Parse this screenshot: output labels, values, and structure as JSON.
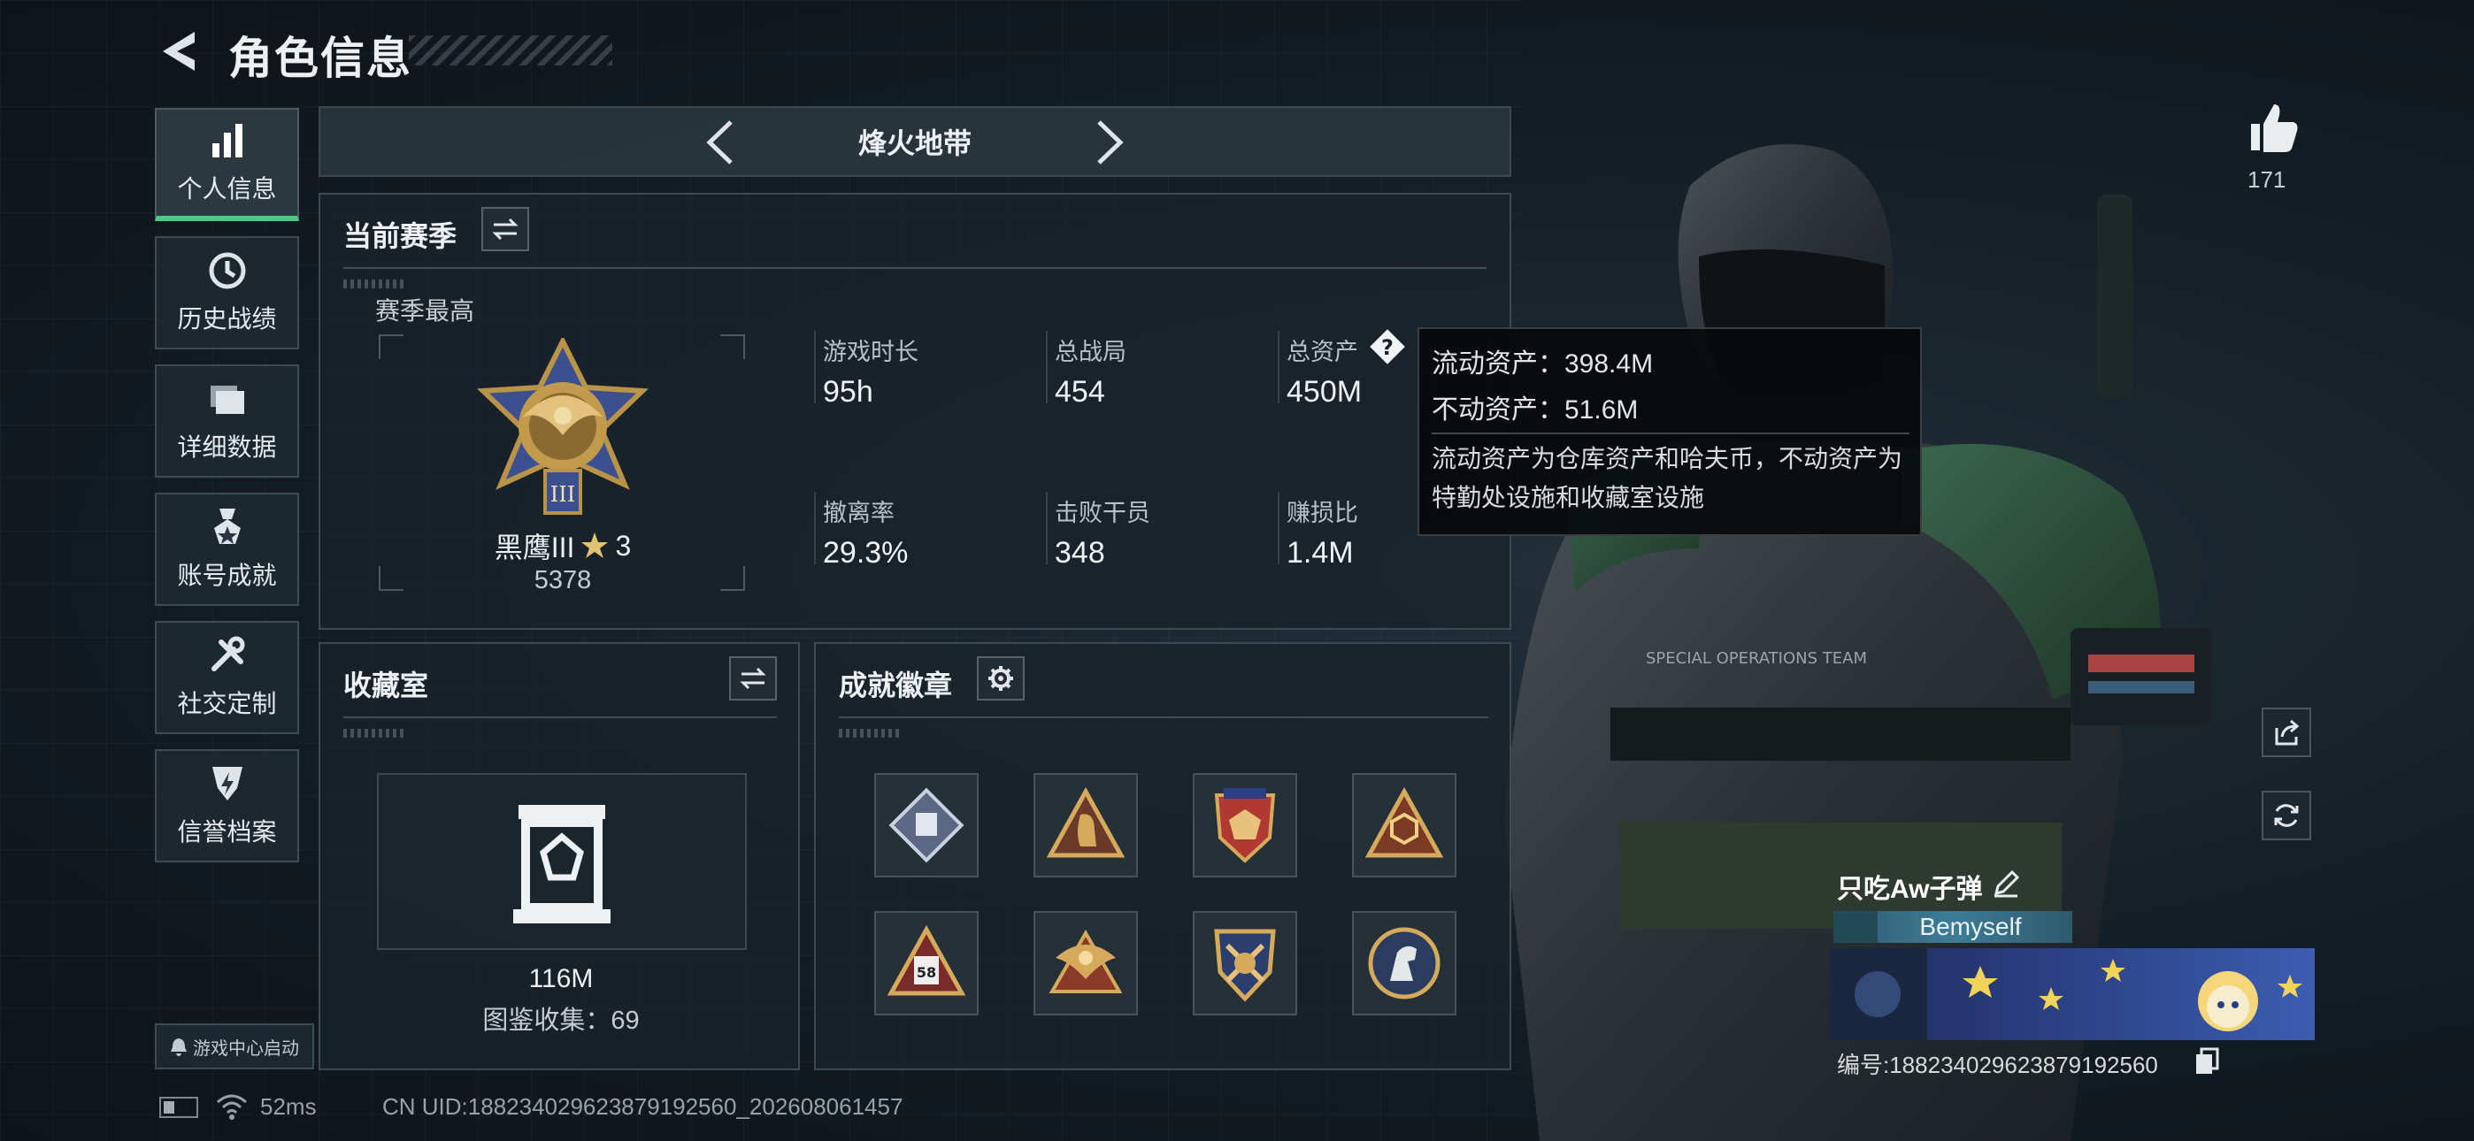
{
  "header": {
    "title": "角色信息"
  },
  "nav": {
    "items": [
      {
        "label": "个人信息",
        "icon": "bar-chart-icon",
        "active": true
      },
      {
        "label": "历史战绩",
        "icon": "clock-icon"
      },
      {
        "label": "详细数据",
        "icon": "folder-icon"
      },
      {
        "label": "账号成就",
        "icon": "medal-icon"
      },
      {
        "label": "社交定制",
        "icon": "wrench-icon"
      },
      {
        "label": "信誉档案",
        "icon": "shield-icon"
      }
    ],
    "launch_label": "游戏中心启动"
  },
  "mode": {
    "title": "烽火地带"
  },
  "season": {
    "heading": "当前赛季",
    "best_label": "赛季最高",
    "rank_name": "黑鹰III",
    "rank_stars": "3",
    "rank_score": "5378",
    "stats": [
      {
        "label": "游戏时长",
        "value": "95h"
      },
      {
        "label": "总战局",
        "value": "454"
      },
      {
        "label": "总资产",
        "value": "450M"
      },
      {
        "label": "撤离率",
        "value": "29.3%"
      },
      {
        "label": "击败干员",
        "value": "348"
      },
      {
        "label": "赚损比",
        "value": "1.4M"
      }
    ]
  },
  "tooltip": {
    "liquid": "流动资产：398.4M",
    "fixed": "不动资产：51.6M",
    "description": "流动资产为仓库资产和哈夫币，不动资产为特勤处设施和收藏室设施"
  },
  "collection": {
    "heading": "收藏室",
    "value": "116M",
    "catalog": "图鉴收集：69"
  },
  "achievements": {
    "heading": "成就徽章",
    "badges": [
      "diamond-badge",
      "bird-badge",
      "shield-star-badge",
      "hexagon-badge",
      "triangle-58-badge",
      "eagle-badge",
      "crossed-arrows-badge",
      "horse-badge"
    ],
    "badge_58": "58"
  },
  "profile": {
    "likes": "171",
    "name": "只吃Aw子弹",
    "title_tag": "Bemyself",
    "id": "编号:1882340296238791925​60"
  },
  "status": {
    "ping": "52ms",
    "uid": "CN UID:188234029623879192560_202608061457"
  },
  "colors": {
    "accent": "#49c98a",
    "panel": "#19232a",
    "tooltip": "#08090b"
  }
}
